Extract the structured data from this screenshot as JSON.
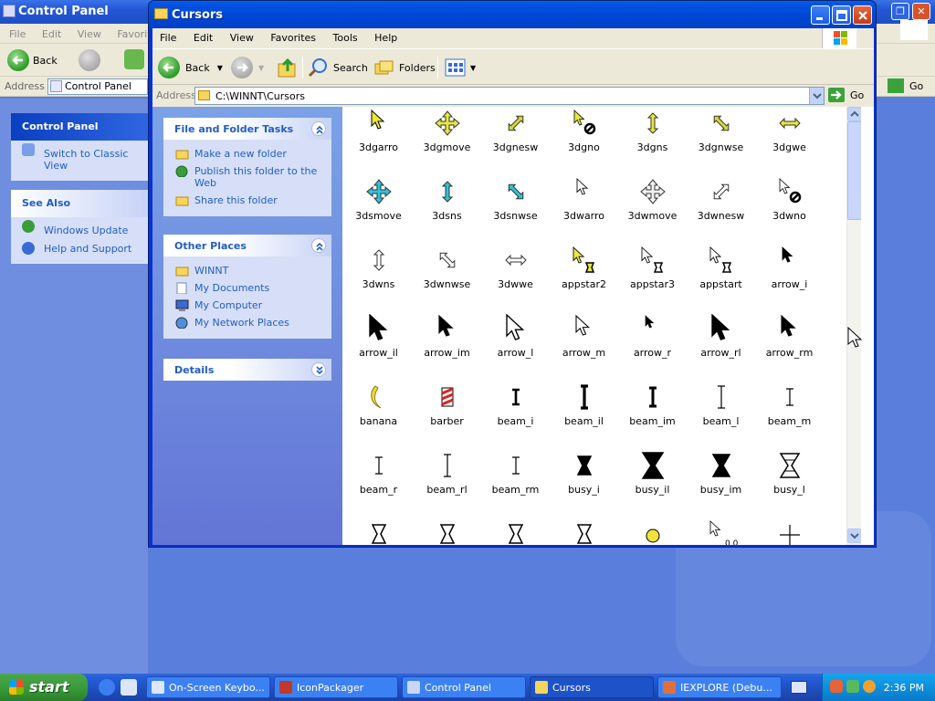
{
  "background_window": {
    "title": "Control Panel",
    "menu": [
      "File",
      "Edit",
      "View",
      "Favorites"
    ],
    "back_label": "Back",
    "address_label": "Address",
    "address_value": "Control Panel",
    "go_label": "Go",
    "panel_title": "Control Panel",
    "switch_label": "Switch to Classic View",
    "see_also_title": "See Also",
    "see_also_items": [
      "Windows Update",
      "Help and Support"
    ]
  },
  "window": {
    "title": "Cursors",
    "menu": [
      "File",
      "Edit",
      "View",
      "Favorites",
      "Tools",
      "Help"
    ],
    "toolbar": {
      "back": "Back",
      "search": "Search",
      "folders": "Folders"
    },
    "address_label": "Address",
    "address_value": "C:\\WINNT\\Cursors",
    "go_label": "Go"
  },
  "taskpane": {
    "file_tasks": {
      "title": "File and Folder Tasks",
      "items": [
        "Make a new folder",
        "Publish this folder to the Web",
        "Share this folder"
      ]
    },
    "other_places": {
      "title": "Other Places",
      "items": [
        "WINNT",
        "My Documents",
        "My Computer",
        "My Network Places"
      ]
    },
    "details": {
      "title": "Details"
    }
  },
  "files": [
    {
      "name": "3dgarro",
      "icon": "arrow-yellow-icon"
    },
    {
      "name": "3dgmove",
      "icon": "move-yellow-icon"
    },
    {
      "name": "3dgnesw",
      "icon": "resize-nesw-yellow-icon"
    },
    {
      "name": "3dgno",
      "icon": "no-yellow-icon"
    },
    {
      "name": "3dgns",
      "icon": "resize-ns-yellow-icon"
    },
    {
      "name": "3dgnwse",
      "icon": "resize-nwse-yellow-icon"
    },
    {
      "name": "3dgwe",
      "icon": "resize-we-yellow-icon"
    },
    {
      "name": "3dsmove",
      "icon": "move-teal-icon"
    },
    {
      "name": "3dsns",
      "icon": "resize-ns-teal-icon"
    },
    {
      "name": "3dsnwse",
      "icon": "resize-nwse-teal-icon"
    },
    {
      "name": "3dwarro",
      "icon": "arrow-white-icon"
    },
    {
      "name": "3dwmove",
      "icon": "move-white-icon"
    },
    {
      "name": "3dwnesw",
      "icon": "resize-nesw-white-icon"
    },
    {
      "name": "3dwno",
      "icon": "no-white-icon"
    },
    {
      "name": "3dwns",
      "icon": "resize-ns-white-icon"
    },
    {
      "name": "3dwnwse",
      "icon": "resize-nwse-white-icon"
    },
    {
      "name": "3dwwe",
      "icon": "resize-we-white-icon"
    },
    {
      "name": "appstar2",
      "icon": "appstarting-yellow-icon"
    },
    {
      "name": "appstar3",
      "icon": "appstarting-white-icon"
    },
    {
      "name": "appstart",
      "icon": "appstarting-icon"
    },
    {
      "name": "arrow_i",
      "icon": "arrow-black-icon"
    },
    {
      "name": "arrow_il",
      "icon": "arrow-black-large-icon"
    },
    {
      "name": "arrow_im",
      "icon": "arrow-black-medium-icon"
    },
    {
      "name": "arrow_l",
      "icon": "arrow-white-large-icon"
    },
    {
      "name": "arrow_m",
      "icon": "arrow-white-medium-icon"
    },
    {
      "name": "arrow_r",
      "icon": "arrow-black-small-icon"
    },
    {
      "name": "arrow_rl",
      "icon": "arrow-black-large-icon"
    },
    {
      "name": "arrow_rm",
      "icon": "arrow-black-medium-icon"
    },
    {
      "name": "banana",
      "icon": "banana-icon"
    },
    {
      "name": "barber",
      "icon": "barber-pole-icon"
    },
    {
      "name": "beam_i",
      "icon": "ibeam-bold-icon"
    },
    {
      "name": "beam_il",
      "icon": "ibeam-large-icon"
    },
    {
      "name": "beam_im",
      "icon": "ibeam-medium-icon"
    },
    {
      "name": "beam_l",
      "icon": "ibeam-thin-large-icon"
    },
    {
      "name": "beam_m",
      "icon": "ibeam-thin-icon"
    },
    {
      "name": "beam_r",
      "icon": "ibeam-thin-icon"
    },
    {
      "name": "beam_rl",
      "icon": "ibeam-thin-large-icon"
    },
    {
      "name": "beam_rm",
      "icon": "ibeam-thin-icon"
    },
    {
      "name": "busy_i",
      "icon": "hourglass-black-icon"
    },
    {
      "name": "busy_il",
      "icon": "hourglass-black-large-icon"
    },
    {
      "name": "busy_im",
      "icon": "hourglass-black-medium-icon"
    },
    {
      "name": "busy_l",
      "icon": "hourglass-white-icon"
    },
    {
      "name": "",
      "icon": "hourglass-icon"
    },
    {
      "name": "",
      "icon": "hourglass-icon"
    },
    {
      "name": "",
      "icon": "hourglass-icon"
    },
    {
      "name": "",
      "icon": "hourglass-icon"
    },
    {
      "name": "",
      "icon": "circle-yellow-icon"
    },
    {
      "name": "",
      "icon": "arrow-coordinate-icon",
      "label": "0,0"
    },
    {
      "name": "",
      "icon": "crosshair-icon"
    }
  ],
  "taskbar": {
    "start_label": "start",
    "tasks": [
      "On-Screen Keybo...",
      "IconPackager",
      "Control Panel",
      "Cursors",
      "IEXPLORE (Debu..."
    ],
    "active_task": "Cursors",
    "clock": "2:36 PM"
  }
}
